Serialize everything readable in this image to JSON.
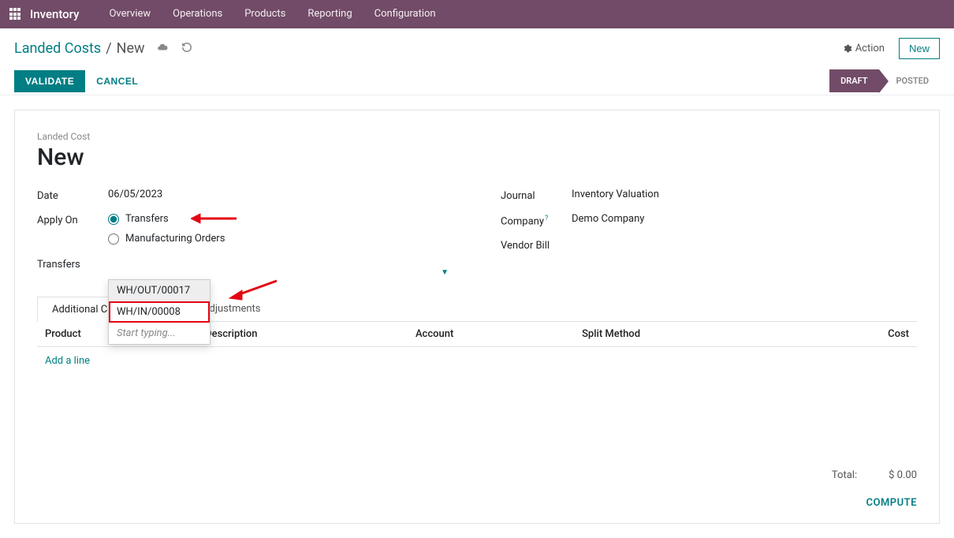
{
  "topbar": {
    "app_name": "Inventory",
    "menu": [
      "Overview",
      "Operations",
      "Products",
      "Reporting",
      "Configuration"
    ]
  },
  "breadcrumb": {
    "parent": "Landed Costs",
    "current": "New"
  },
  "actions": {
    "action_label": "Action",
    "new_label": "New",
    "validate": "VALIDATE",
    "cancel": "CANCEL"
  },
  "status": {
    "draft": "DRAFT",
    "posted": "POSTED"
  },
  "sheet": {
    "subtitle": "Landed Cost",
    "title": "New",
    "date_label": "Date",
    "date_value": "06/05/2023",
    "apply_on_label": "Apply On",
    "apply_options": {
      "transfers": "Transfers",
      "mo": "Manufacturing Orders"
    },
    "journal_label": "Journal",
    "journal_value": "Inventory Valuation",
    "company_label": "Company",
    "company_value": "Demo Company",
    "vendor_bill_label": "Vendor Bill",
    "transfers_label": "Transfers"
  },
  "dropdown": {
    "items": [
      "WH/OUT/00017",
      "WH/IN/00008"
    ],
    "start_typing": "Start typing..."
  },
  "tabs": {
    "additional": "Additional Costs",
    "adjustments": "Valuation Adjustments"
  },
  "columns": {
    "product": "Product",
    "description": "Description",
    "account": "Account",
    "split": "Split Method",
    "cost": "Cost"
  },
  "lines": {
    "add": "Add a line"
  },
  "totals": {
    "label": "Total:",
    "value": "$ 0.00",
    "compute": "COMPUTE"
  }
}
